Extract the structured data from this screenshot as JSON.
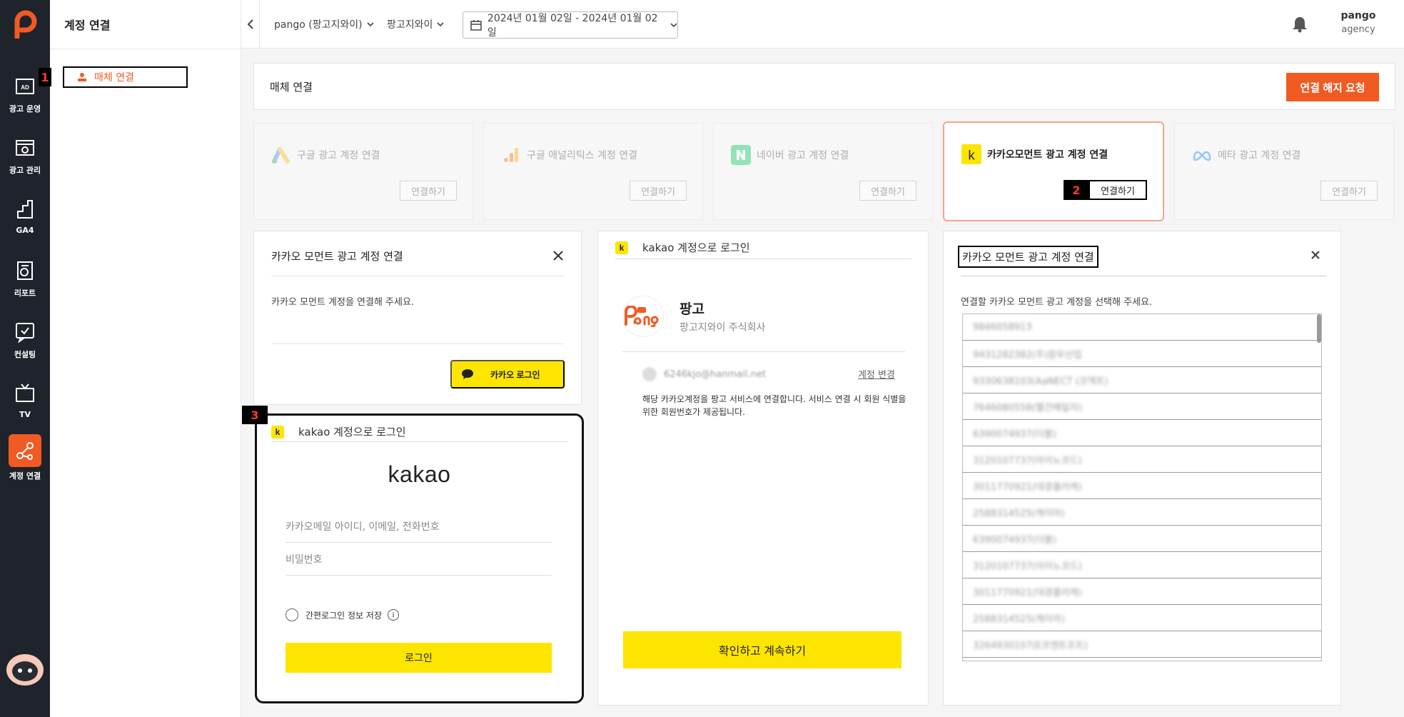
{
  "sidebar": {
    "items": [
      {
        "label": "광고 운영",
        "icon": "ad-icon"
      },
      {
        "label": "광고 관리",
        "icon": "ad-settings-icon"
      },
      {
        "label": "GA4",
        "icon": "ga4-chart-icon"
      },
      {
        "label": "리포트",
        "icon": "report-icon"
      },
      {
        "label": "컨설팅",
        "icon": "consulting-icon"
      },
      {
        "label": "TV",
        "icon": "tv-icon"
      },
      {
        "label": "계정 연결",
        "icon": "account-link-icon"
      }
    ]
  },
  "submenu": {
    "title": "계정 연결",
    "item": "매체 연결"
  },
  "badges": [
    "1",
    "2",
    "3"
  ],
  "topbar": {
    "advertiser": "pango (팡고지와이)",
    "account": "팡고지와이",
    "date_range": "2024년 01월 02일 - 2024년 01월 02일",
    "user_name": "pango",
    "user_role": "agency"
  },
  "header": {
    "title": "매체 연결",
    "disconnect_button": "연결 해지 요청"
  },
  "media_cards": [
    {
      "title": "구글 광고 계정 연결",
      "button": "연결하기",
      "icon": "google-ads-icon"
    },
    {
      "title": "구글 애널리틱스 계정 연결",
      "button": "연결하기",
      "icon": "google-analytics-icon"
    },
    {
      "title": "네이버 광고 계정 연결",
      "button": "연결하기",
      "icon": "naver-icon"
    },
    {
      "title": "카카오모먼트 광고 계정 연결",
      "button": "연결하기",
      "icon": "kakao-icon"
    },
    {
      "title": "메타 광고 계정 연결",
      "button": "연결하기",
      "icon": "meta-icon"
    }
  ],
  "panel_connect": {
    "title": "카카오 모먼트 광고 계정 연결",
    "desc": "카카오 모먼트 계정을 연결해 주세요.",
    "kakao_login_button": "카카오 로그인"
  },
  "panel_login": {
    "header": "kakao 계정으로 로그인",
    "kakao_icon_letter": "k",
    "brand": "kakao",
    "id_placeholder": "카카오메일 아이디, 이메일, 전화번호",
    "pw_placeholder": "비밀번호",
    "save_label": "간편로그인 정보 저장",
    "info_glyph": "i",
    "login_button": "로그인"
  },
  "panel_consent": {
    "header": "kakao 계정으로 로그인",
    "kakao_icon_letter": "k",
    "service_name": "팡고",
    "company": "팡고지와이 주식회사",
    "email": "6246kjo@hanmail.net",
    "change_account": "계정 변경",
    "consent_text": "해당 카카오계정을 팡고 서비스에 연결합니다. 서비스 연결 시 회원 식별을 위한 회원번호가 제공됩니다.",
    "confirm_button": "확인하고 계속하기"
  },
  "panel_select": {
    "title": "카카오 모먼트 광고 계정 연결",
    "desc": "연결할 카카오 모먼트 광고 계정을 선택해 주세요.",
    "accounts": [
      "9846058913",
      "9431282382(주)참우산업",
      "9330638103(AaNECT (코엑트)",
      "7646080558(헬건매일자)",
      "6390074937(더블)",
      "3120107737(아이노코드)",
      "3011770921(대경플러케)",
      "2588314525(캐이마)",
      "6390074937(더블)",
      "3120107737(아이노코드)",
      "3011770921(대경플러케)",
      "2588314525(캐이마)",
      "3264930107(E코엔트조트)"
    ]
  },
  "colors": {
    "brand": "#f15a22",
    "kakao_yellow": "#fee500",
    "rail_bg": "#1f232c"
  }
}
